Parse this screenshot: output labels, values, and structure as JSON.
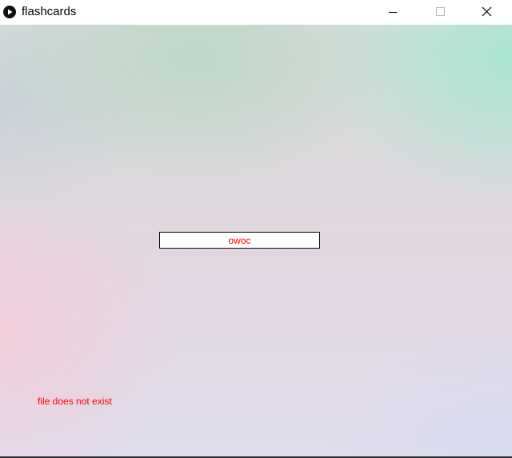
{
  "window": {
    "title": "flashcards",
    "icon": "play-circle-icon",
    "controls": {
      "minimize_icon": "minimize-icon",
      "maximize_icon": "maximize-icon",
      "close_icon": "close-icon"
    }
  },
  "canvas": {
    "input": {
      "value": "owoc",
      "text_color": "#ff0000"
    },
    "status_message": "file does not exist",
    "status_color": "#ff0000"
  }
}
